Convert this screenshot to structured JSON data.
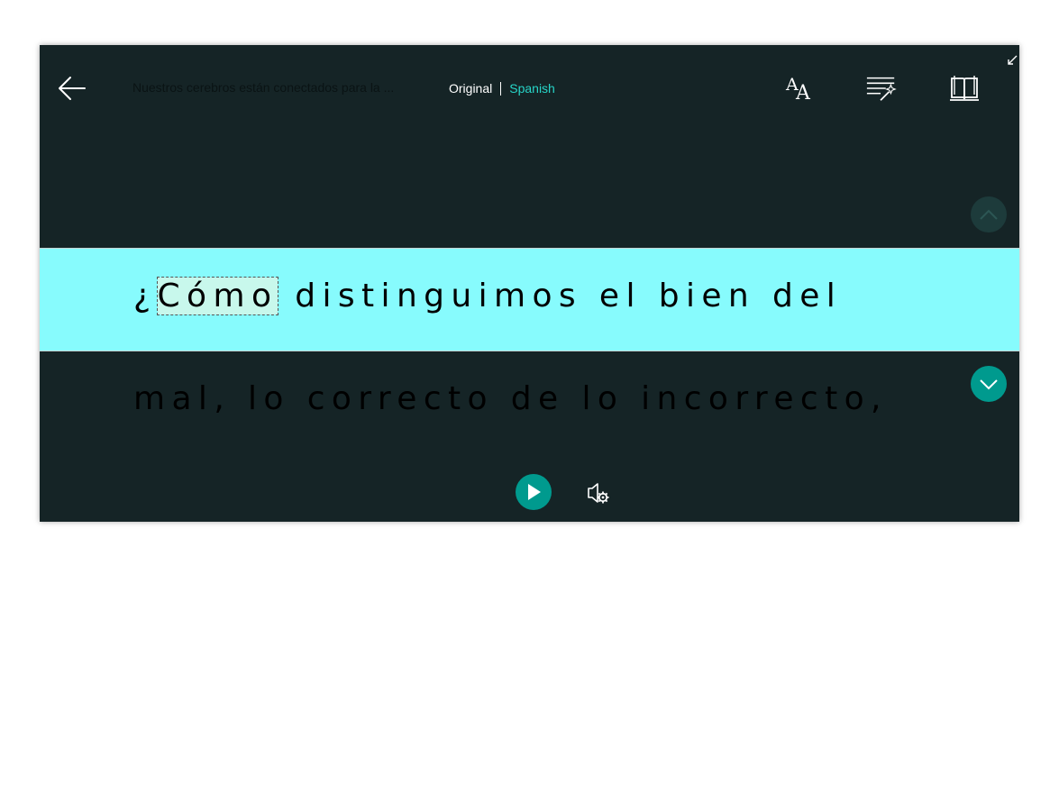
{
  "header": {
    "doc_title": "Nuestros cerebros están conectados para la ...",
    "lang_original": "Original",
    "lang_translated": "Spanish"
  },
  "toolbar": {
    "text_size_icon": "text-size-icon",
    "grammar_icon": "grammar-options-icon",
    "reading_prefs_icon": "book-icon"
  },
  "reader": {
    "active_line": {
      "before": "¿",
      "current_word": "Cómo",
      "after": " distinguimos el bien del"
    },
    "next_line": "mal, lo correcto de lo incorrecto,"
  },
  "colors": {
    "background": "#152426",
    "highlight_band": "#87fbfd",
    "current_word_bg": "#c8f8ec",
    "accent": "#009a8e",
    "translated_lang": "#27d5c8"
  }
}
